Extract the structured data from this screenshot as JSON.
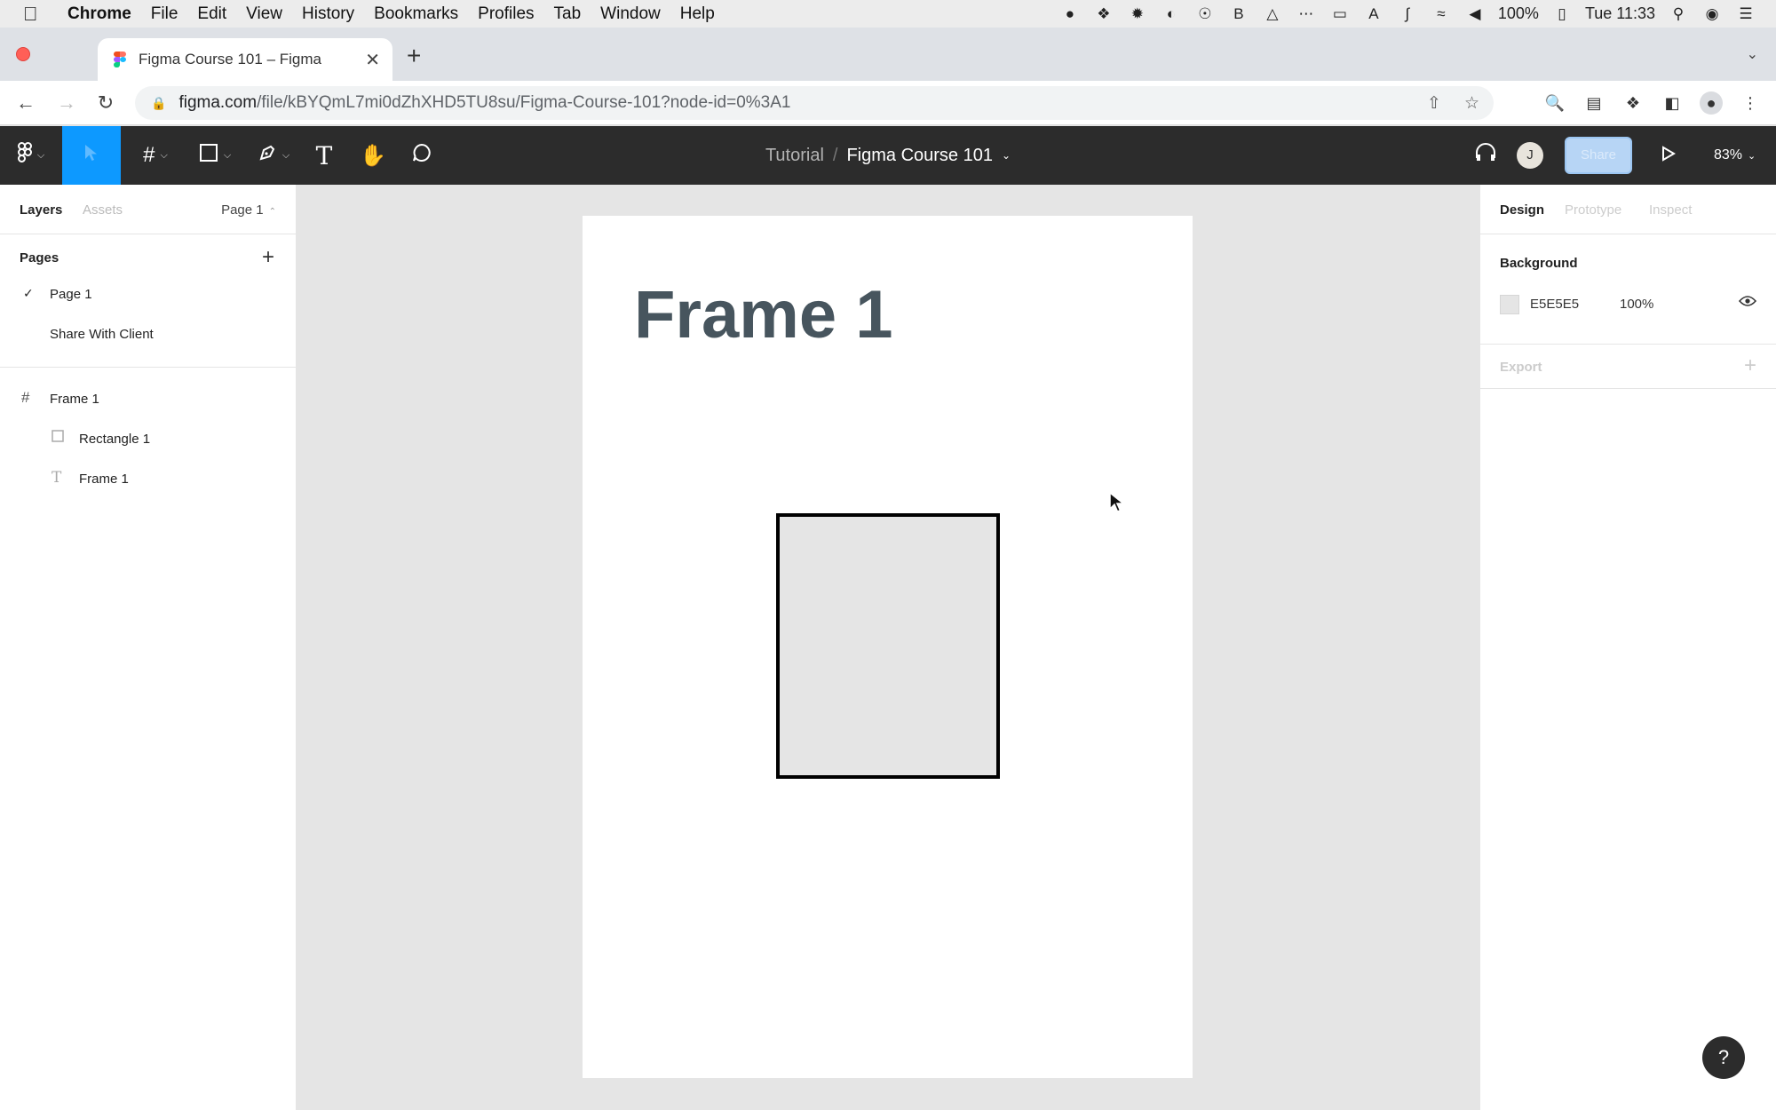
{
  "menubar": {
    "apple_icon": "apple-icon",
    "app_name": "Chrome",
    "items": [
      "File",
      "Edit",
      "View",
      "History",
      "Bookmarks",
      "Profiles",
      "Tab",
      "Window",
      "Help"
    ],
    "battery": "100%",
    "clock": "Tue 11:33"
  },
  "browser": {
    "tab_title": "Figma Course 101 – Figma",
    "url_host": "figma.com",
    "url_path": "/file/kBYQmL7mi0dZhXHD5TU8su/Figma-Course-101?node-id=0%3A1"
  },
  "figma_toolbar": {
    "team": "Tutorial",
    "separator": "/",
    "file_name": "Figma Course 101",
    "avatar_initial": "J",
    "share_label": "Share",
    "zoom": "83%",
    "tools": [
      {
        "name": "main-menu",
        "icon": "figma-logo-icon"
      },
      {
        "name": "move-tool",
        "icon": "move-icon"
      },
      {
        "name": "frame-tool",
        "icon": "frame-icon"
      },
      {
        "name": "shape-tool",
        "icon": "rectangle-icon"
      },
      {
        "name": "pen-tool",
        "icon": "pen-icon"
      },
      {
        "name": "text-tool",
        "icon": "text-icon"
      },
      {
        "name": "hand-tool",
        "icon": "hand-icon"
      },
      {
        "name": "comment-tool",
        "icon": "comment-icon"
      }
    ]
  },
  "left_panel": {
    "tabs": {
      "layers": "Layers",
      "assets": "Assets",
      "current_page": "Page 1"
    },
    "pages_label": "Pages",
    "pages": [
      {
        "label": "Page 1",
        "selected": true
      },
      {
        "label": "Share With Client",
        "selected": false
      }
    ],
    "layers": [
      {
        "label": "Frame 1",
        "type": "frame",
        "icon": "frame-icon",
        "depth": 0
      },
      {
        "label": "Rectangle 1",
        "type": "rectangle",
        "icon": "rectangle-icon",
        "depth": 1
      },
      {
        "label": "Frame 1",
        "type": "text",
        "icon": "text-icon",
        "depth": 1
      }
    ]
  },
  "canvas": {
    "frame_heading": "Frame 1",
    "background": "#e5e5e5",
    "rectangle_fill": "#e5e5e5",
    "rectangle_stroke": "#000000"
  },
  "right_panel": {
    "tabs": [
      "Design",
      "Prototype",
      "Inspect"
    ],
    "background_label": "Background",
    "background_hex": "E5E5E5",
    "background_opacity": "100%",
    "export_label": "Export"
  },
  "help_label": "?"
}
